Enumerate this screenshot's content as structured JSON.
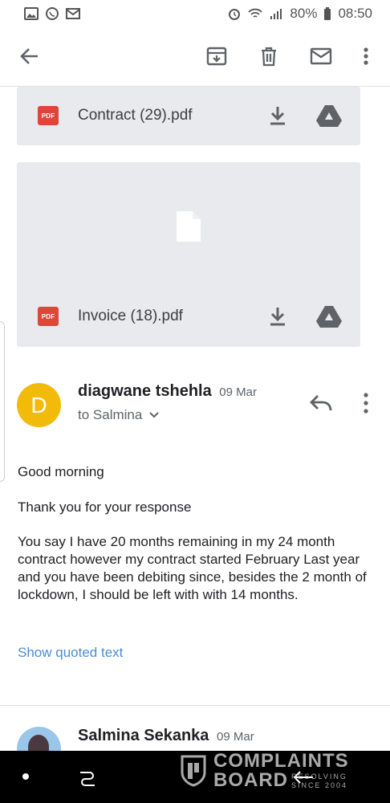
{
  "status_bar": {
    "battery": "80%",
    "time": "08:50",
    "left_icons": [
      "gallery-icon",
      "whatsapp-icon",
      "gmail-icon"
    ],
    "right_icons": [
      "alarm-icon",
      "wifi-icon",
      "signal-icon",
      "battery-icon"
    ]
  },
  "toolbar": {
    "icons": [
      "back-arrow-icon",
      "archive-icon",
      "delete-icon",
      "mark-unread-icon",
      "more-vert-icon"
    ]
  },
  "attachments": [
    {
      "badge": "PDF",
      "name": "Contract (29).pdf"
    },
    {
      "badge": "PDF",
      "name": "Invoice (18).pdf"
    }
  ],
  "message": {
    "avatar_letter": "D",
    "avatar_color": "#f2bb0c",
    "sender": "diagwane tshehla",
    "date": "09 Mar",
    "recipient": "to Salmina",
    "greeting": "Good morning",
    "thanks": "Thank you for your response",
    "paragraph": "You say I have 20 months remaining in my 24 month contract however my contract started February Last year and you have been debiting since, besides the 2 month of lockdown, I should be left with with 14 months.",
    "quoted_link": "Show quoted text"
  },
  "next_message": {
    "sender": "Salmina Sekanka",
    "date": "09 Mar"
  },
  "watermark": {
    "line1": "COMPLAINTS",
    "line2": "BOARD",
    "tag1": "RESOLVING",
    "tag2": "SINCE 2004"
  },
  "colors": {
    "link": "#4a8fd4",
    "pdf_badge": "#e0453a",
    "card_bg": "#e8eaed"
  }
}
